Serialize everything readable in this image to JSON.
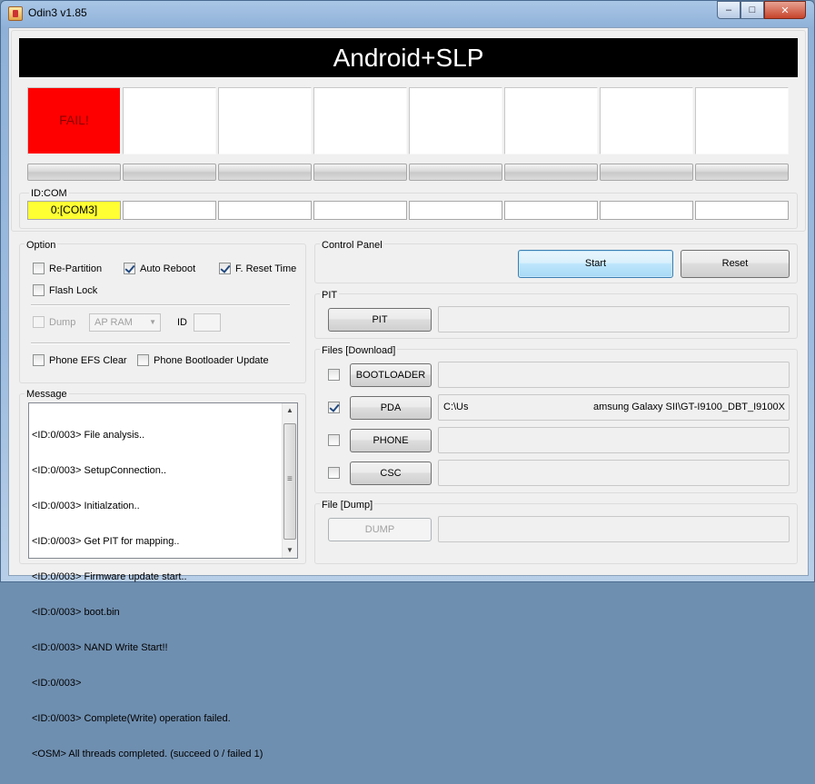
{
  "window": {
    "title": "Odin3 v1.85",
    "min_label": "–",
    "max_label": "□",
    "close_label": "✕"
  },
  "banner": "Android+SLP",
  "status_cells": [
    {
      "text": "FAIL!",
      "state": "fail",
      "color": "#ff0000"
    },
    {
      "text": ""
    },
    {
      "text": ""
    },
    {
      "text": ""
    },
    {
      "text": ""
    },
    {
      "text": ""
    },
    {
      "text": ""
    },
    {
      "text": ""
    }
  ],
  "idcom": {
    "label": "ID:COM",
    "ports": [
      "0:[COM3]",
      "",
      "",
      "",
      "",
      "",
      "",
      ""
    ],
    "active_color": "#ffff33"
  },
  "option": {
    "title": "Option",
    "re_partition": {
      "label": "Re-Partition",
      "checked": false
    },
    "auto_reboot": {
      "label": "Auto Reboot",
      "checked": true
    },
    "f_reset_time": {
      "label": "F. Reset Time",
      "checked": true
    },
    "flash_lock": {
      "label": "Flash Lock",
      "checked": false
    },
    "dump": {
      "label": "Dump",
      "checked": false,
      "enabled": false
    },
    "dump_select": "AP RAM",
    "id_label": "ID",
    "phone_efs_clear": {
      "label": "Phone EFS Clear",
      "checked": false
    },
    "phone_bootloader_update": {
      "label": "Phone Bootloader Update",
      "checked": false
    }
  },
  "message": {
    "title": "Message",
    "lines": [
      "<ID:0/003> File analysis..",
      "<ID:0/003> SetupConnection..",
      "<ID:0/003> Initialzation..",
      "<ID:0/003> Get PIT for mapping..",
      "<ID:0/003> Firmware update start..",
      "<ID:0/003> boot.bin",
      "<ID:0/003> NAND Write Start!!",
      "<ID:0/003>",
      "<ID:0/003> Complete(Write) operation failed.",
      "<OSM> All threads completed. (succeed 0 / failed 1)"
    ]
  },
  "control_panel": {
    "title": "Control Panel",
    "start_label": "Start",
    "reset_label": "Reset"
  },
  "pit": {
    "title": "PIT",
    "button_label": "PIT",
    "path": ""
  },
  "files": {
    "title": "Files [Download]",
    "rows": [
      {
        "label": "BOOTLOADER",
        "checked": false,
        "path_left": "",
        "path_right": ""
      },
      {
        "label": "PDA",
        "checked": true,
        "path_left": "C:\\Us",
        "path_right": "amsung Galaxy SII\\GT-I9100_DBT_I9100X"
      },
      {
        "label": "PHONE",
        "checked": false,
        "path_left": "",
        "path_right": ""
      },
      {
        "label": "CSC",
        "checked": false,
        "path_left": "",
        "path_right": ""
      }
    ]
  },
  "file_dump": {
    "title": "File [Dump]",
    "button_label": "DUMP",
    "path": ""
  }
}
